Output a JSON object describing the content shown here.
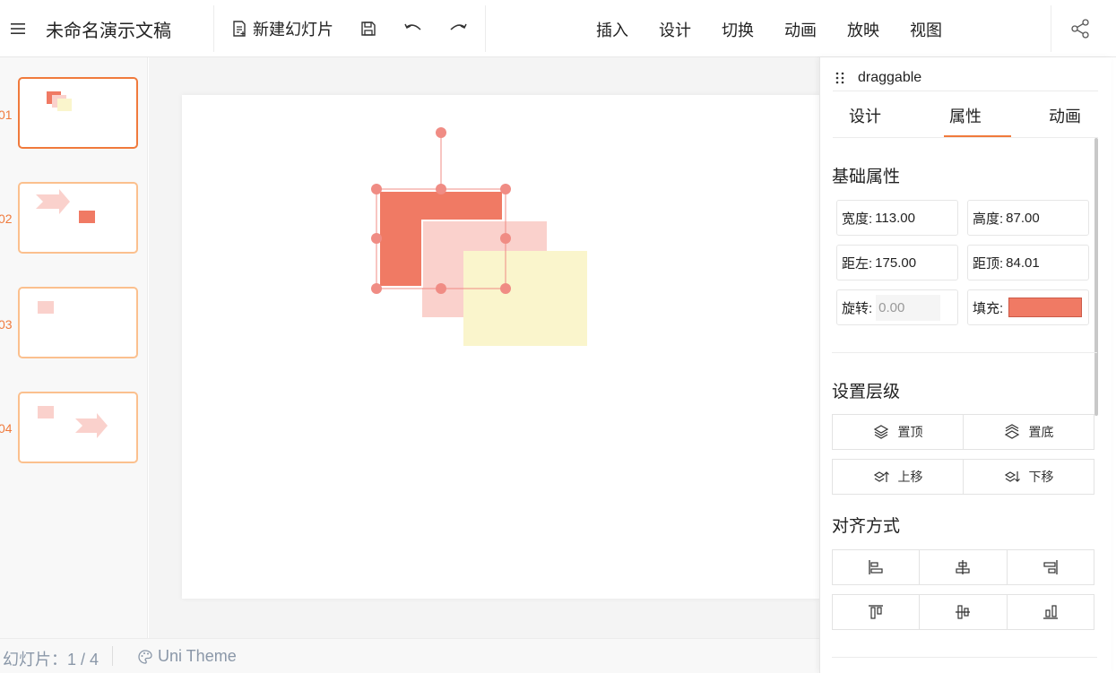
{
  "header": {
    "title": "未命名演示文稿",
    "new_slide": "新建幻灯片",
    "nav": [
      "插入",
      "设计",
      "切换",
      "动画",
      "放映",
      "视图"
    ]
  },
  "thumbnails": [
    {
      "number": "01"
    },
    {
      "number": "02"
    },
    {
      "number": "03"
    },
    {
      "number": "04"
    }
  ],
  "status": {
    "slide_count": "幻灯片：1 / 4",
    "theme": "Uni Theme"
  },
  "panel": {
    "drag_label": "draggable",
    "tabs": [
      "设计",
      "属性",
      "动画"
    ],
    "active_tab": "属性",
    "basic_title": "基础属性",
    "fields": {
      "width_label": "宽度:",
      "width_value": "113.00",
      "height_label": "高度:",
      "height_value": "87.00",
      "left_label": "距左:",
      "left_value": "175.00",
      "top_label": "距顶:",
      "top_value": "84.01",
      "rotate_label": "旋转:",
      "rotate_value": "0.00",
      "fill_label": "填充:"
    },
    "layer_title": "设置层级",
    "layer_buttons": [
      "置顶",
      "置底",
      "上移",
      "下移"
    ],
    "align_title": "对齐方式"
  },
  "colors": {
    "accent": "#f07a3c",
    "shape_fill": "#f07a64",
    "shape_light": "#fad1cc",
    "shape_yellow": "#faf5cc"
  }
}
